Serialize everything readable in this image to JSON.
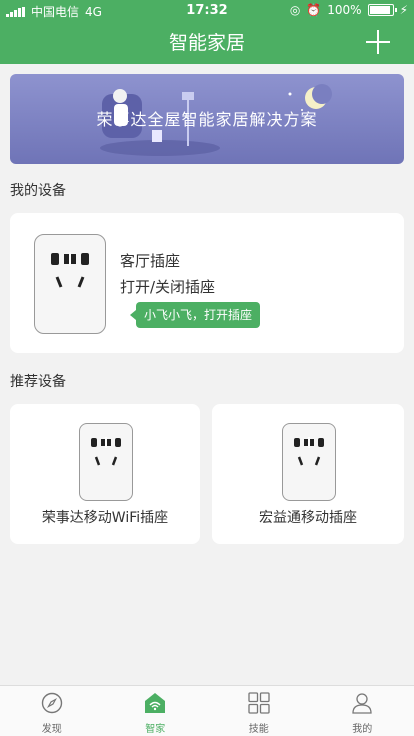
{
  "status": {
    "carrier": "中国电信",
    "network": "4G",
    "time": "17:32",
    "battery": "100%"
  },
  "header": {
    "title": "智能家居"
  },
  "banner": {
    "text": "荣事达全屋智能家居解决方案"
  },
  "sections": {
    "my_devices": "我的设备",
    "recommended": "推荐设备"
  },
  "my_device": {
    "name": "客厅插座",
    "desc": "打开/关闭插座",
    "voice_hint": "小飞小飞，打开插座"
  },
  "recommended": [
    {
      "label": "荣事达移动WiFi插座"
    },
    {
      "label": "宏益通移动插座"
    }
  ],
  "tabs": [
    {
      "label": "发现",
      "icon": "compass-icon"
    },
    {
      "label": "智家",
      "icon": "home-icon"
    },
    {
      "label": "技能",
      "icon": "grid-icon"
    },
    {
      "label": "我的",
      "icon": "user-icon"
    }
  ],
  "colors": {
    "accent": "#4caf63"
  }
}
